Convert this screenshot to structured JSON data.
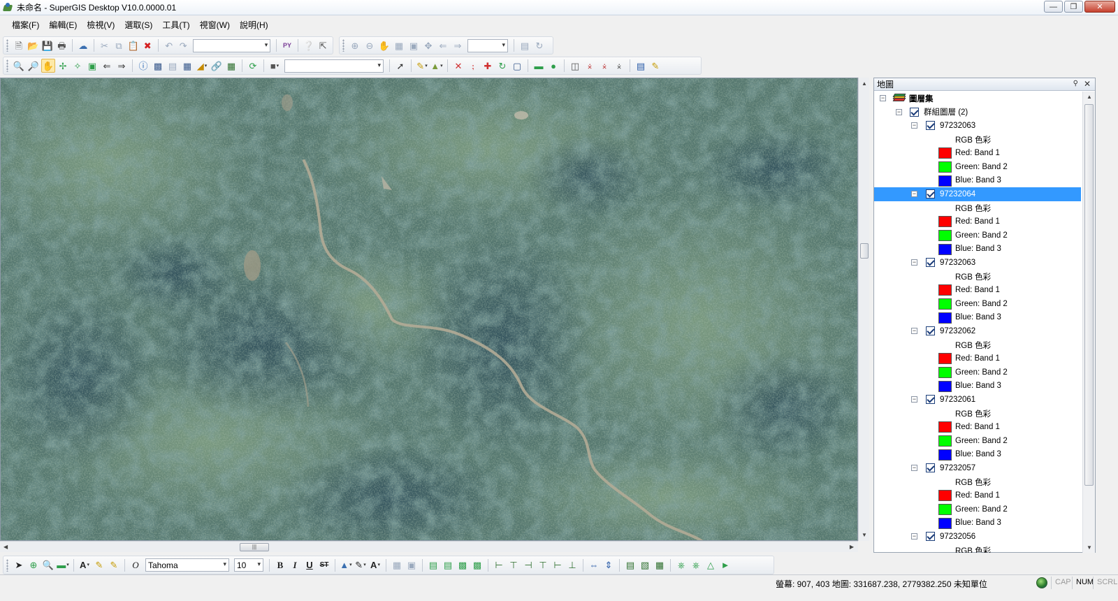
{
  "window": {
    "title": "未命名 - SuperGIS Desktop V10.0.0000.01",
    "controls": [
      "minimize",
      "restore",
      "close"
    ]
  },
  "menu": [
    "檔案(F)",
    "編輯(E)",
    "檢視(V)",
    "選取(S)",
    "工具(T)",
    "視窗(W)",
    "說明(H)"
  ],
  "toolbar_standard": {
    "buttons": [
      "new-icon",
      "open-icon",
      "save-icon",
      "print-icon",
      "connect-icon",
      "cut-icon",
      "copy-icon",
      "paste-icon",
      "delete-icon",
      "undo-icon",
      "redo-icon",
      "python-icon",
      "help-icon",
      "whats-this-icon"
    ],
    "scale_value": ""
  },
  "toolbar_zoom": {
    "buttons": [
      "fixed-zoom-in-icon",
      "fixed-zoom-out-icon",
      "pan-icon",
      "full-extent-icon",
      "zoom-layer-icon",
      "center-icon",
      "back-extent-icon",
      "forward-extent-icon",
      "layout-icon",
      "refresh-icon"
    ],
    "combo_value": ""
  },
  "toolbar_tools": {
    "buttons": [
      "zoom-in-icon",
      "zoom-out-icon",
      "pan-hand-icon",
      "full-extent-icon",
      "zoom-selected-icon",
      "previous-extent-icon",
      "next-extent-icon",
      "identify-icon",
      "select-feature-icon",
      "hyperlink-icon",
      "find-icon",
      "measure-icon",
      "link-icon",
      "table-icon",
      "refresh-map-icon",
      "camera-icon",
      "edit-arrow-icon",
      "sketch-pencil-icon",
      "vertex-icon",
      "split-icon",
      "move-icon",
      "snap-icon",
      "rotate-icon",
      "rectangle-icon",
      "circle-icon",
      "mirror-icon",
      "reshape-icon",
      "trim-icon",
      "extend-icon",
      "attributes-icon",
      "edit-brush-icon"
    ],
    "layer_combo_value": ""
  },
  "map": {
    "description_alt": "aerial imagery of forested mountains with a dirt road"
  },
  "panel": {
    "title": "地圖",
    "root": "圖層集",
    "group": "群組圖層 (2)",
    "rgb_label": "RGB 色彩",
    "bands": [
      {
        "label": "Red: Band 1",
        "color": "#ff0000"
      },
      {
        "label": "Green: Band 2",
        "color": "#00ff00"
      },
      {
        "label": "Blue: Band 3",
        "color": "#0000ff"
      }
    ],
    "layers": [
      "97232063",
      "97232064",
      "97232063",
      "97232062",
      "97232061",
      "97232057",
      "97232056"
    ],
    "selected_index": 1
  },
  "drawing_toolbar": {
    "font_name": "Tahoma",
    "font_size": "10",
    "buttons": [
      "select-element-icon",
      "rotate-element-icon",
      "zoom-element-icon",
      "rectangle-draw-icon",
      "text-icon",
      "callout-icon",
      "edit-text-icon",
      "font-icon",
      "bold-icon",
      "italic-icon",
      "underline-icon",
      "strikethrough-icon",
      "fill-color-icon",
      "line-color-icon",
      "font-color-icon",
      "group-icon",
      "ungroup-icon",
      "bring-front-icon",
      "send-back-icon",
      "bring-forward-icon",
      "send-backward-icon",
      "align-left-icon",
      "align-center-icon",
      "align-right-icon",
      "align-top-icon",
      "align-middle-icon",
      "align-bottom-icon",
      "distribute-horizontal-icon",
      "distribute-vertical-icon",
      "same-width-icon",
      "same-height-icon",
      "same-size-icon",
      "nudge-icon",
      "flip-horizontal-icon",
      "flip-vertical-icon",
      "rotate-right-icon"
    ]
  },
  "status": {
    "coords_text": "螢幕: 907, 403  地圖: 331687.238, 2779382.250 未知單位",
    "indicators": [
      {
        "label": "CAP",
        "active": false
      },
      {
        "label": "NUM",
        "active": true
      },
      {
        "label": "SCRL",
        "active": false
      }
    ]
  }
}
